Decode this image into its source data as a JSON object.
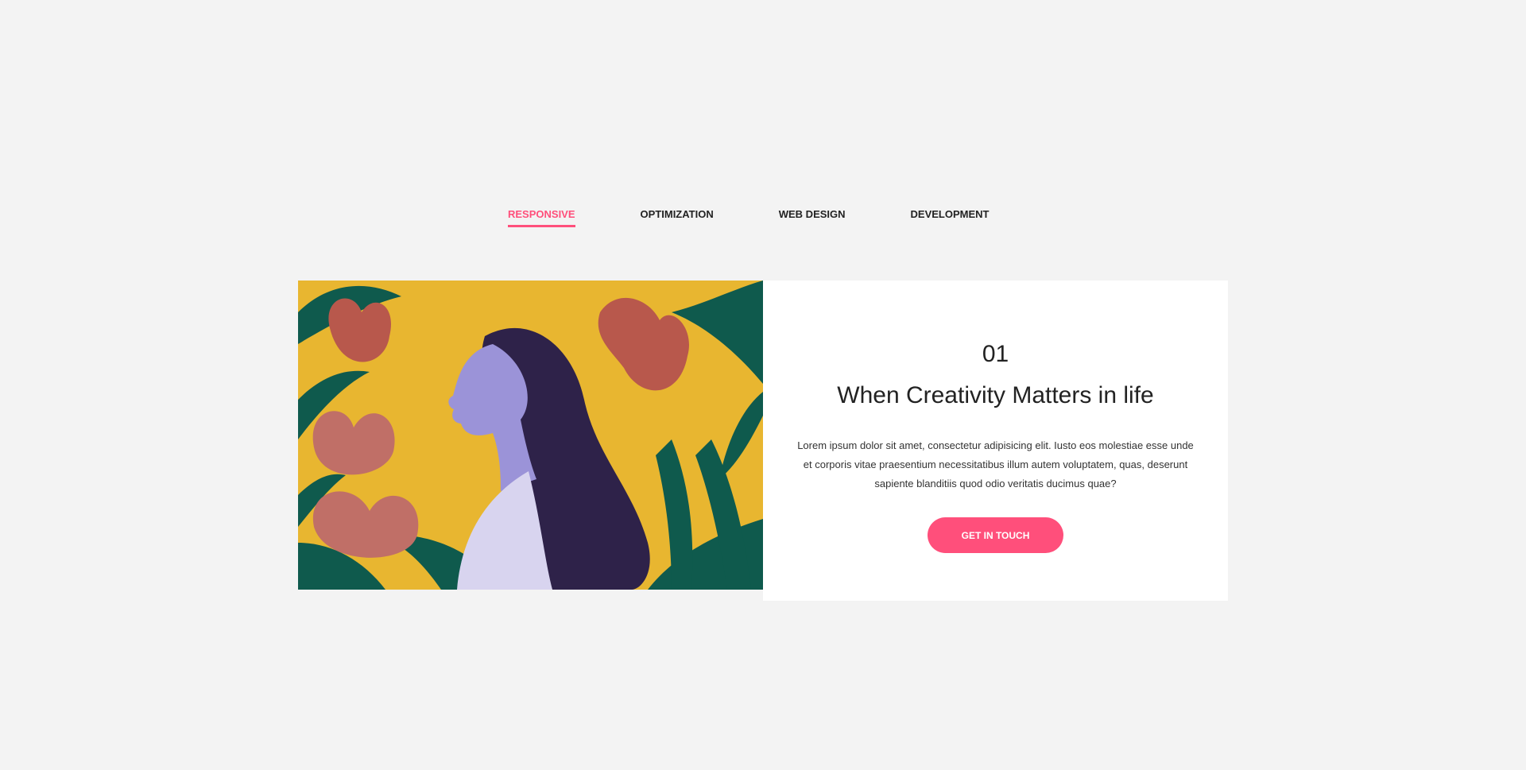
{
  "tabs": [
    {
      "label": "RESPONSIVE",
      "active": true
    },
    {
      "label": "OPTIMIZATION",
      "active": false
    },
    {
      "label": "WEB DESIGN",
      "active": false
    },
    {
      "label": "DEVELOPMENT",
      "active": false
    }
  ],
  "card": {
    "number": "01",
    "title": "When Creativity Matters in life",
    "body": "Lorem ipsum dolor sit amet, consectetur adipisicing elit. Iusto eos molestiae esse unde et corporis vitae praesentium necessitatibus illum autem voluptatem, quas, deserunt sapiente blanditiis quod odio veritatis ducimus quae?",
    "button_label": "GET IN TOUCH",
    "image_icon": "illustration-woman-flowers"
  },
  "colors": {
    "accent": "#ff4f7b",
    "background": "#f3f3f3",
    "card": "#ffffff",
    "image_yellow": "#e8b630",
    "leaf_green": "#0f5a4d",
    "flower_rose": "#b8584c",
    "skin_lilac": "#9b93d8",
    "hair_dark": "#2e2249"
  }
}
